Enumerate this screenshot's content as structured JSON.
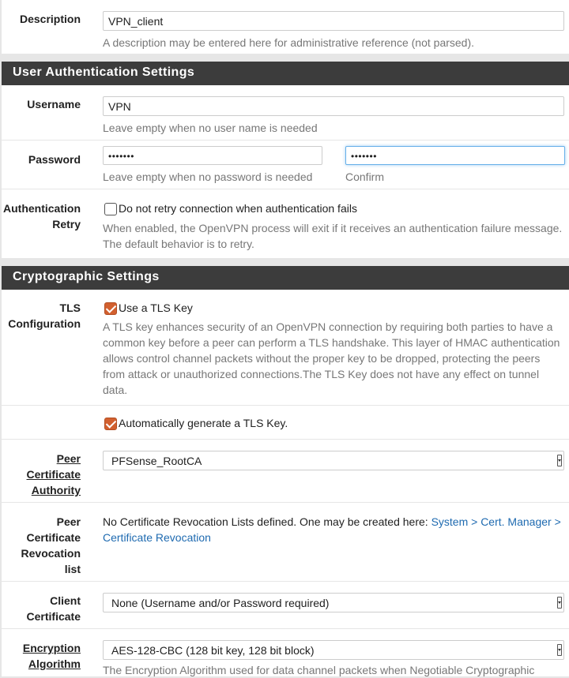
{
  "description": {
    "label": "Description",
    "value": "VPN_client",
    "help": "A description may be entered here for administrative reference (not parsed)."
  },
  "user_auth": {
    "heading": "User Authentication Settings",
    "username": {
      "label": "Username",
      "value": "VPN",
      "help": "Leave empty when no user name is needed"
    },
    "password": {
      "label": "Password",
      "value": "•••••••",
      "confirm_value": "•••••••",
      "help": "Leave empty when no password is needed",
      "confirm_label": "Confirm"
    },
    "auth_retry": {
      "label_line1": "Authentication",
      "label_line2": "Retry",
      "checkbox_label": "Do not retry connection when authentication fails",
      "checked": false,
      "help": "When enabled, the OpenVPN process will exit if it receives an authentication failure message. The default behavior is to retry."
    }
  },
  "crypto": {
    "heading": "Cryptographic Settings",
    "tls": {
      "label_line1": "TLS",
      "label_line2": "Configuration",
      "checkbox_label": "Use a TLS Key",
      "checked": true,
      "help": "A TLS key enhances security of an OpenVPN connection by requiring both parties to have a common key before a peer can perform a TLS handshake. This layer of HMAC authentication allows control channel packets without the proper key to be dropped, protecting the peers from attack or unauthorized connections.The TLS Key does not have any effect on tunnel data."
    },
    "auto_tls": {
      "checkbox_label": "Automatically generate a TLS Key.",
      "checked": true
    },
    "peer_ca": {
      "label_line1": "Peer",
      "label_line2": "Certificate",
      "label_line3": "Authority",
      "selected": "PFSense_RootCA"
    },
    "peer_crl": {
      "label_line1": "Peer",
      "label_line2": "Certificate",
      "label_line3": "Revocation",
      "label_line4": "list",
      "text": "No Certificate Revocation Lists defined. One may be created here: ",
      "link_text": "System > Cert. Manager > Certificate Revocation"
    },
    "client_cert": {
      "label_line1": "Client",
      "label_line2": "Certificate",
      "selected": "None (Username and/or Password required)"
    },
    "encryption": {
      "label_line1": "Encryption",
      "label_line2": "Algorithm",
      "selected": "AES-128-CBC (128 bit key, 128 bit block)",
      "help": "The Encryption Algorithm used for data channel packets when Negotiable Cryptographic"
    }
  }
}
